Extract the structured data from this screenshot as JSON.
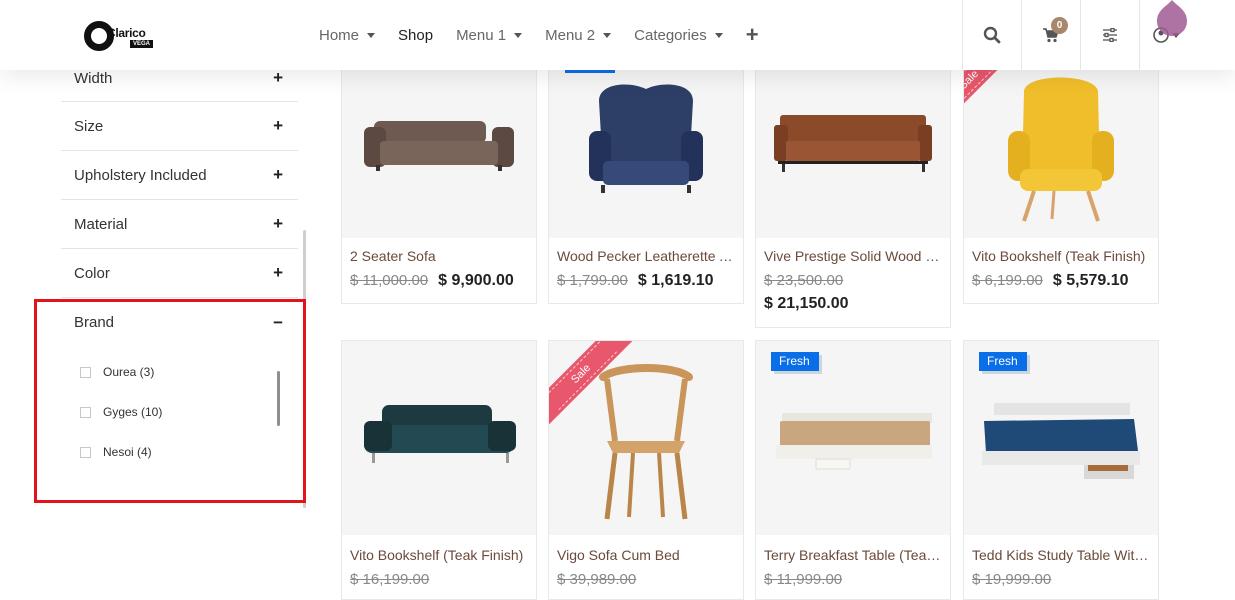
{
  "header": {
    "logo_text": "Clarico",
    "logo_sub": "VEGA",
    "nav": [
      {
        "label": "Home",
        "dropdown": true,
        "active": false
      },
      {
        "label": "Shop",
        "dropdown": false,
        "active": true
      },
      {
        "label": "Menu 1",
        "dropdown": true,
        "active": false
      },
      {
        "label": "Menu 2",
        "dropdown": true,
        "active": false
      },
      {
        "label": "Categories",
        "dropdown": true,
        "active": false
      }
    ],
    "cart_count": "0",
    "icons": [
      "search-icon",
      "cart-icon",
      "filter-sliders-icon",
      "user-icon"
    ]
  },
  "sidebar": {
    "filters": [
      {
        "label": "Width",
        "sign": "+"
      },
      {
        "label": "Size",
        "sign": "+"
      },
      {
        "label": "Upholstery Included",
        "sign": "+"
      },
      {
        "label": "Material",
        "sign": "+"
      },
      {
        "label": "Color",
        "sign": "+"
      },
      {
        "label": "Brand",
        "sign": "−"
      }
    ],
    "brand_options": [
      {
        "label": "Ourea (3)"
      },
      {
        "label": "Gyges (10)"
      },
      {
        "label": "Nesoi (4)"
      }
    ]
  },
  "products": [
    {
      "name": "2 Seater Sofa",
      "old": "$ 11,000.00",
      "new": "$ 9,900.00",
      "tag": ""
    },
    {
      "name": "Wood Pecker Leatherette Armchair",
      "old": "$ 1,799.00",
      "new": "$ 1,619.10",
      "tag": ""
    },
    {
      "name": "Vive Prestige Solid Wood Sofa",
      "old": "$ 23,500.00",
      "new": "$ 21,150.00",
      "tag": ""
    },
    {
      "name": "Vito Bookshelf (Teak Finish)",
      "old": "$ 6,199.00",
      "new": "$ 5,579.10",
      "tag": "Sale"
    },
    {
      "name": "Vito Bookshelf (Teak Finish)",
      "old": "$ 16,199.00",
      "new": "",
      "tag": ""
    },
    {
      "name": "Vigo Sofa Cum Bed",
      "old": "$ 39,989.00",
      "new": "",
      "tag": "Sale"
    },
    {
      "name": "Terry Breakfast Table (Teak Finish)",
      "old": "$ 11,999.00",
      "new": "",
      "tag": "Fresh"
    },
    {
      "name": "Tedd Kids Study Table With Drawer",
      "old": "$ 19,999.00",
      "new": "",
      "tag": "Fresh"
    }
  ],
  "colors": {
    "accent": "#a8876d",
    "highlight": "#e2141b",
    "fresh": "#0a6ee8",
    "sale": "#e8576c"
  }
}
